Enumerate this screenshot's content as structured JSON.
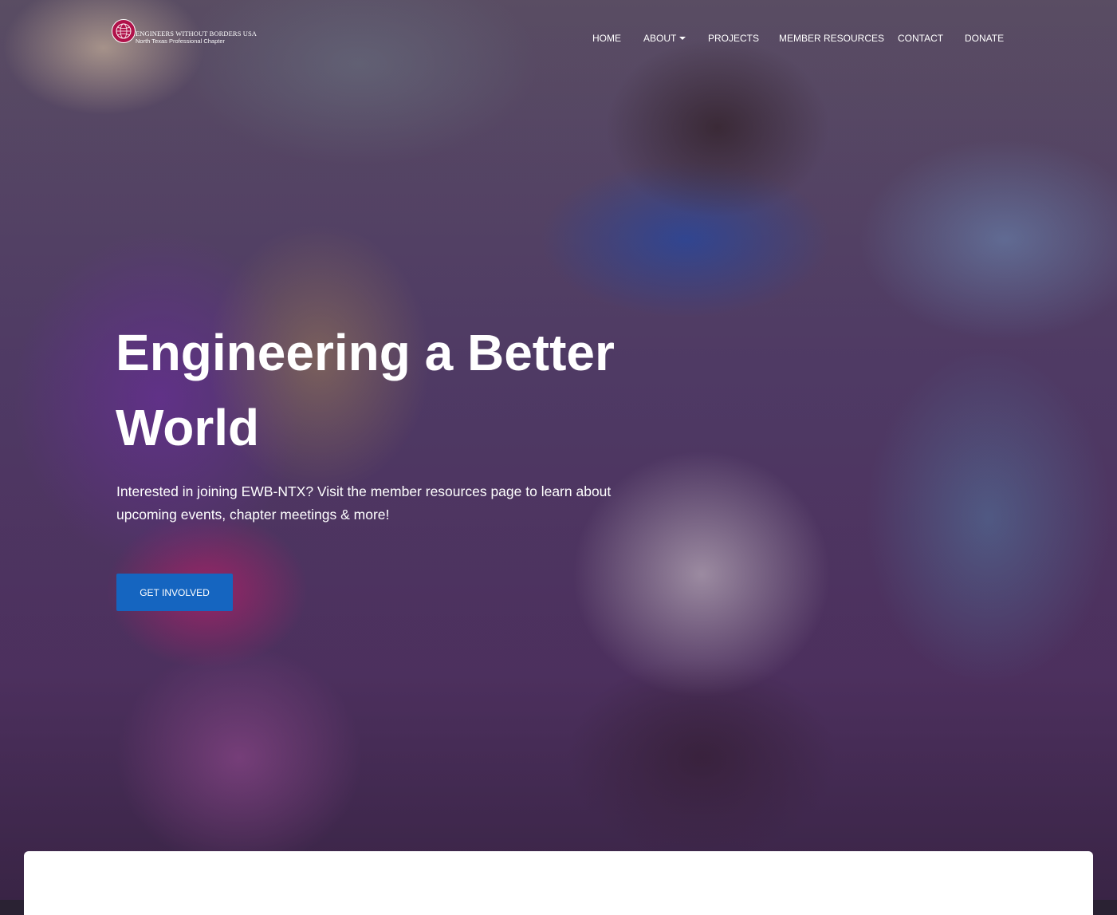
{
  "brand": {
    "name": "ENGINEERS WITHOUT BORDERS USA",
    "chapter": "North Texas Professional Chapter",
    "logo_icon": "globe-icon",
    "logo_color": "#b0124a"
  },
  "nav": {
    "items": [
      {
        "label": "HOME"
      },
      {
        "label": "ABOUT",
        "has_dropdown": true
      },
      {
        "label": "PROJECTS"
      },
      {
        "label": "MEMBER RESOURCES"
      },
      {
        "label": "CONTACT"
      },
      {
        "label": "DONATE"
      }
    ]
  },
  "hero": {
    "headline": "Engineering a Better World",
    "subtext": "Interested in joining EWB-NTX? Visit the member resources page to learn about upcoming events, chapter meetings & more!",
    "cta_label": "GET INVOLVED",
    "cta_color": "#1565c0"
  }
}
